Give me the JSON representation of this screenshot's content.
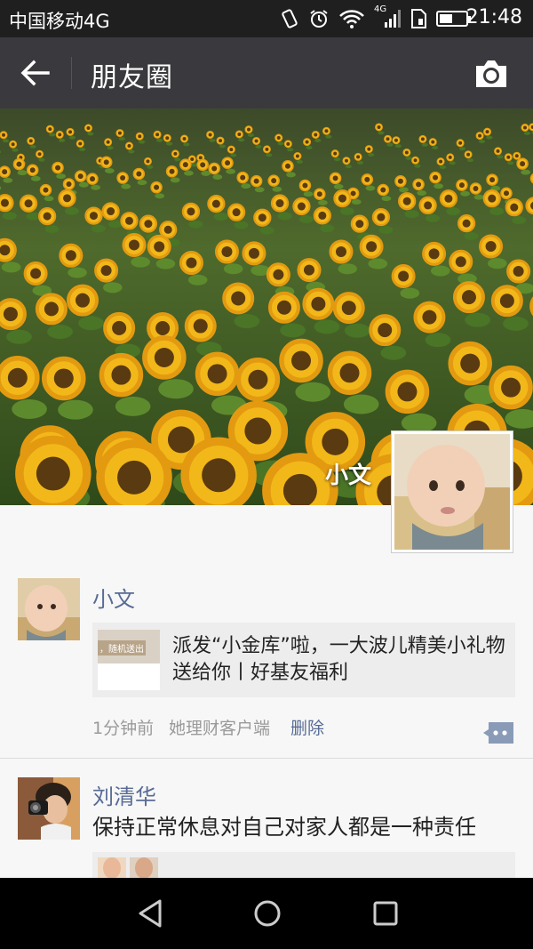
{
  "status_bar": {
    "carrier": "中国移动4G",
    "time": "21:48",
    "network": "4G"
  },
  "toolbar": {
    "title": "朋友圈"
  },
  "profile": {
    "name": "小文"
  },
  "feed": [
    {
      "author": "小文",
      "share": {
        "thumb_text": "，随机送出",
        "title": "派发“小金库”啦，一大波儿精美小礼物送给你丨好基友福利"
      },
      "time": "1分钟前",
      "source": "她理财客户端",
      "delete_label": "删除"
    },
    {
      "author": "刘清华",
      "text": "保持正常休息对自己对家人都是一种责任"
    }
  ],
  "colors": {
    "link": "#576b95",
    "toolbar": "#3a3a3e",
    "statusbar": "#1f1f1f",
    "card": "#ededed"
  },
  "icons": [
    "back-arrow-icon",
    "camera-icon",
    "comment-icon",
    "vibrate-icon",
    "alarm-icon",
    "wifi-icon",
    "signal-icon",
    "sim-icon",
    "battery-icon",
    "nav-back-icon",
    "nav-home-icon",
    "nav-recents-icon"
  ]
}
